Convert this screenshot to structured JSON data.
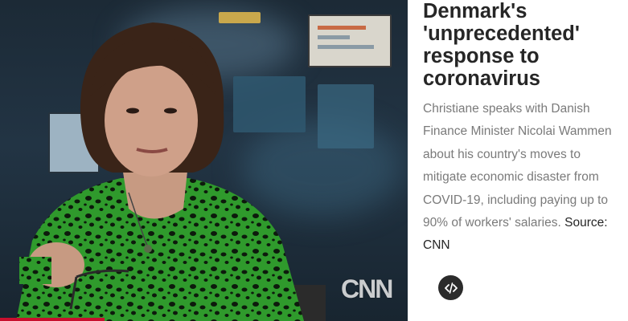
{
  "video": {
    "watermark": "CNN",
    "subject": "presenter",
    "brand_red": "#c8102e"
  },
  "article": {
    "headline": "Denmark's 'unprecedented' response to coronavirus",
    "summary": "Christiane speaks with Danish Finance Minister Nicolai Wammen about his country's moves to mitigate economic disaster from COVID-19, including paying up to 90% of workers' salaries.",
    "source_label": "Source:",
    "source_name": "CNN"
  },
  "controls": {
    "embed_icon": "code-icon"
  }
}
